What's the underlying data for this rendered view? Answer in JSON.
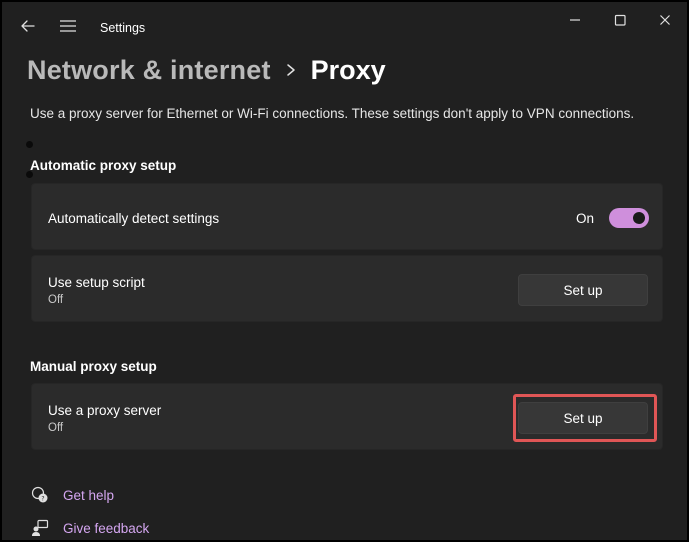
{
  "titlebar": {
    "app_title": "Settings",
    "icons": [
      "back-arrow-icon",
      "hamburger-menu-icon",
      "minimize-icon",
      "maximize-icon",
      "close-icon"
    ]
  },
  "header": {
    "parent": "Network & internet",
    "current": "Proxy"
  },
  "description": "Use a proxy server for Ethernet or Wi-Fi connections. These settings don't apply to VPN connections.",
  "automatic": {
    "title": "Automatic proxy setup",
    "detect": {
      "label": "Automatically detect settings",
      "state": "On"
    },
    "script": {
      "label": "Use setup script",
      "status": "Off",
      "button": "Set up"
    }
  },
  "manual": {
    "title": "Manual proxy setup",
    "proxy": {
      "label": "Use a proxy server",
      "status": "Off",
      "button": "Set up"
    }
  },
  "links": {
    "help": "Get help",
    "feedback": "Give feedback"
  },
  "colors": {
    "accent": "#cf8fdc",
    "link": "#d4a6f0",
    "highlight": "#e05656",
    "background": "#202020",
    "card": "#2b2b2b"
  }
}
